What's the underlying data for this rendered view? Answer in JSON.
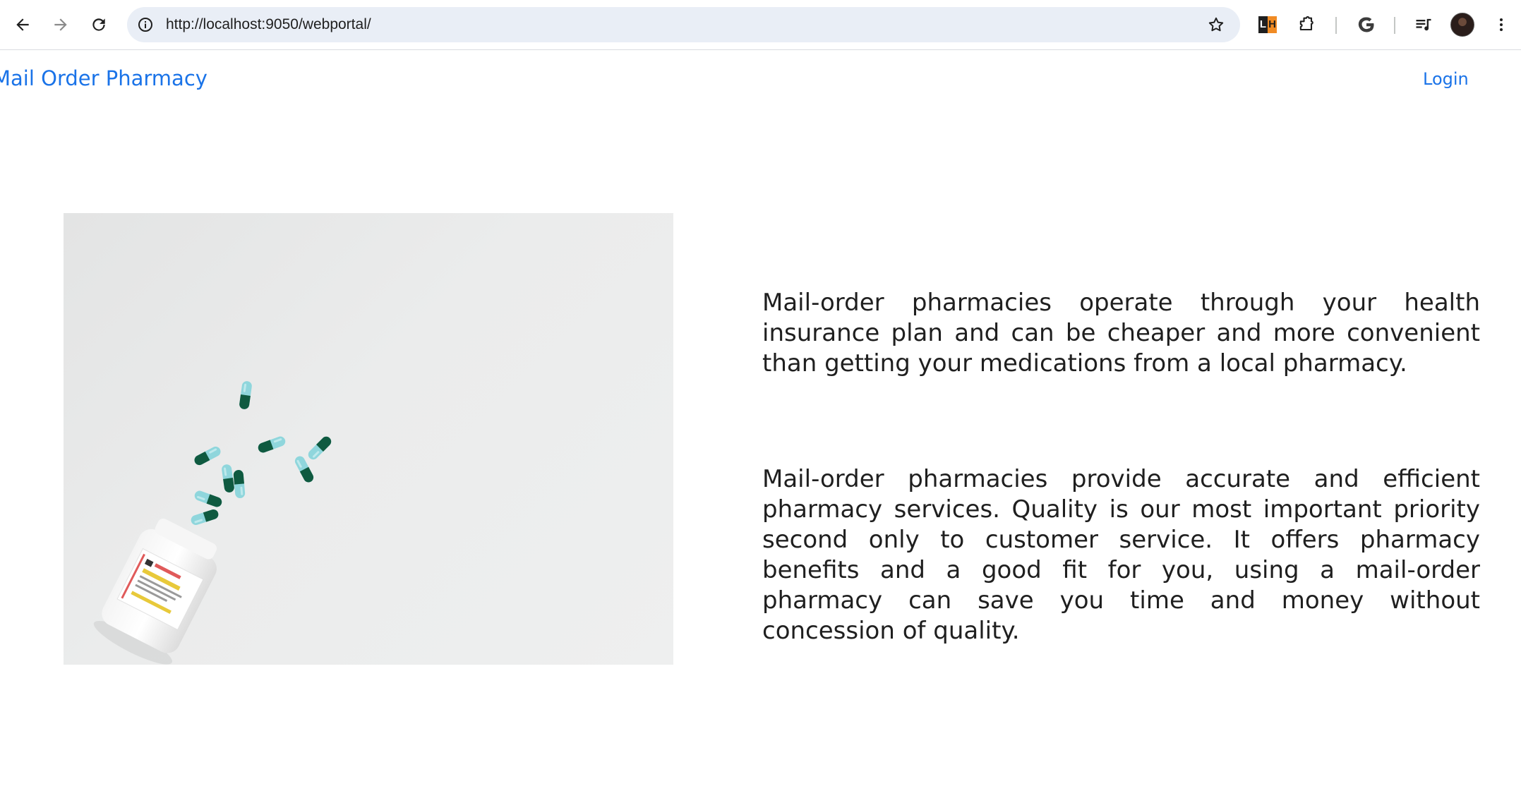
{
  "browser": {
    "url": "http://localhost:9050/webportal/",
    "extension_badge": {
      "left": "L",
      "right": "H"
    },
    "icons": [
      "back-icon",
      "forward-icon",
      "reload-icon",
      "site-info-icon",
      "bookmark-star-icon",
      "lighthouse-icon",
      "extensions-icon",
      "google-icon",
      "media-controls-icon",
      "profile-avatar",
      "more-menu-icon"
    ]
  },
  "navbar": {
    "brand": "Mail Order Pharmacy",
    "login": "Login"
  },
  "hero": {
    "image_alt": "Spilled medicine capsules next to a prescription bottle",
    "paragraphs": [
      "Mail-order pharmacies operate through your health insurance plan and can be cheaper and more convenient than getting your medications from a local pharmacy.",
      "Mail-order pharmacies provide accurate and efficient pharmacy services. Quality is our most important priority second only to customer service. It offers pharmacy benefits and a good fit for you, using a mail-order pharmacy can save you time and money without concession of quality."
    ]
  },
  "colors": {
    "link": "#1a73e8",
    "text": "#1f1f1f",
    "omnibox": "#e9eef6",
    "capsule_dark": "#0f5a40",
    "capsule_light": "#8fd6dc"
  }
}
